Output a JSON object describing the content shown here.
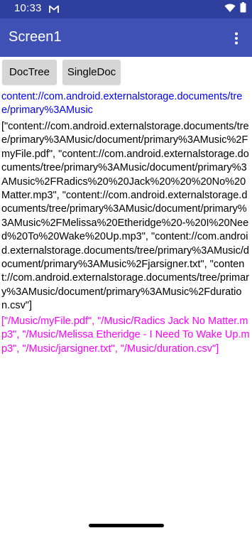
{
  "status_bar": {
    "time": "10:33",
    "icons": [
      "gmail-icon",
      "wifi-icon",
      "battery-icon"
    ]
  },
  "app_bar": {
    "title": "Screen1",
    "menu_icon": "more-vert-icon"
  },
  "buttons": {
    "doc_tree": "DocTree",
    "single_doc": "SingleDoc"
  },
  "content": {
    "tree_uri": "content://com.android.externalstorage.documents/tree/primary%3AMusic",
    "document_uris": "[\"content://com.android.externalstorage.documents/tree/primary%3AMusic/document/primary%3AMusic%2FmyFile.pdf\", \"content://com.android.externalstorage.documents/tree/primary%3AMusic/document/primary%3AMusic%2FRadics%20%20Jack%20%20%20No%20Matter.mp3\", \"content://com.android.externalstorage.documents/tree/primary%3AMusic/document/primary%3AMusic%2FMelissa%20Etheridge%20-%20I%20Need%20To%20Wake%20Up.mp3\", \"content://com.android.externalstorage.documents/tree/primary%3AMusic/document/primary%3AMusic%2Fjarsigner.txt\", \"content://com.android.externalstorage.documents/tree/primary%3AMusic/document/primary%3AMusic%2Fduration.csv\"]",
    "file_paths": "[\"/Music/myFile.pdf\", \"/Music/Radics  Jack   No Matter.mp3\", \"/Music/Melissa Etheridge - I Need To Wake Up.mp3\", \"/Music/jarsigner.txt\", \"/Music/duration.csv\"]"
  },
  "colors": {
    "status_bar": "#2f3f9e",
    "app_bar": "#3f51b5",
    "button": "#d6d6d6",
    "tree_uri_text": "#0000ff",
    "file_paths_text": "#ff00ff"
  }
}
